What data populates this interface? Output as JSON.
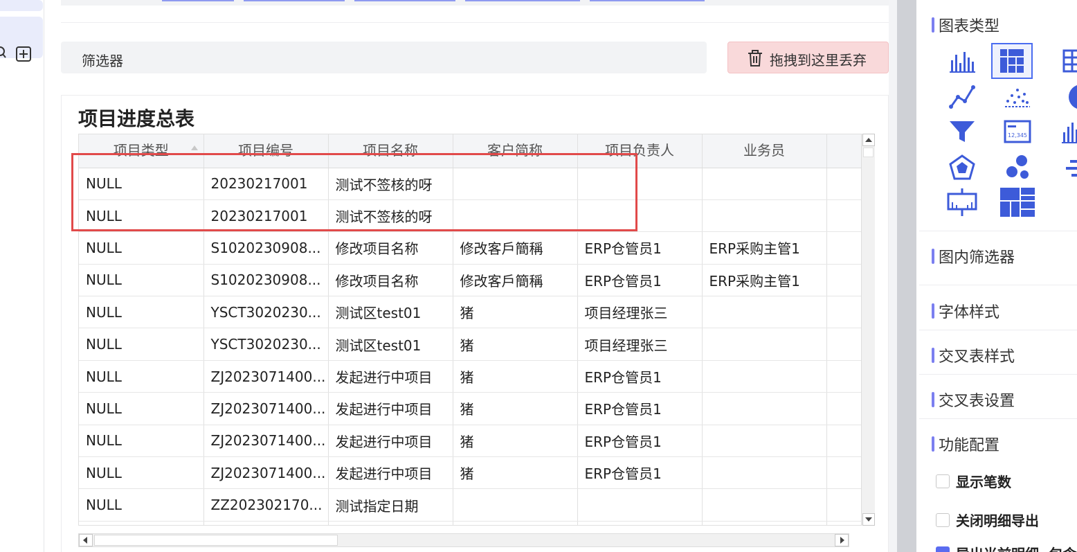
{
  "filter": {
    "label": "筛选器"
  },
  "drop_zone": {
    "label": "拖拽到这里丢弃"
  },
  "report": {
    "title": "项目进度总表",
    "columns": [
      "项目类型",
      "项目编号",
      "项目名称",
      "客户简称",
      "项目负责人",
      "业务员"
    ],
    "rows": [
      [
        "NULL",
        "20230217001",
        "测试不签核的呀",
        "",
        "",
        ""
      ],
      [
        "NULL",
        "20230217001",
        "测试不签核的呀",
        "",
        "",
        ""
      ],
      [
        "NULL",
        "S1020230908...",
        "修改项目名称",
        "修改客戶簡稱",
        "ERP仓管员1",
        "ERP采购主管1"
      ],
      [
        "NULL",
        "S1020230908...",
        "修改项目名称",
        "修改客戶簡稱",
        "ERP仓管员1",
        "ERP采购主管1"
      ],
      [
        "NULL",
        "YSCT3020230...",
        "测试区test01",
        "猪",
        "项目经理张三",
        ""
      ],
      [
        "NULL",
        "YSCT3020230...",
        "测试区test01",
        "猪",
        "项目经理张三",
        ""
      ],
      [
        "NULL",
        "ZJ2023071400...",
        "发起进行中项目",
        "猪",
        "ERP仓管员1",
        ""
      ],
      [
        "NULL",
        "ZJ2023071400...",
        "发起进行中项目",
        "猪",
        "ERP仓管员1",
        ""
      ],
      [
        "NULL",
        "ZJ2023071400...",
        "发起进行中项目",
        "猪",
        "ERP仓管员1",
        ""
      ],
      [
        "NULL",
        "ZJ2023071400...",
        "发起进行中项目",
        "猪",
        "ERP仓管员1",
        ""
      ],
      [
        "NULL",
        "ZZ202302170...",
        "测试指定日期",
        "",
        "",
        ""
      ],
      [
        "",
        "",
        "",
        "",
        "",
        ""
      ]
    ]
  },
  "panel": {
    "chart_type_title": "图表类型",
    "chart_icons": [
      "bar-chart-icon",
      "cross-table-icon",
      "table-icon",
      "line-chart-icon",
      "scatter-icon",
      "pie-icon",
      "funnel-icon",
      "kpi-card-icon",
      "stacked-bar-icon",
      "radar-icon",
      "bubble-icon",
      "gantt-icon",
      "boxplot-icon",
      "treemap-icon"
    ],
    "kpi_sample": "12,345",
    "sections": [
      "图内筛选器",
      "字体样式",
      "交叉表样式",
      "交叉表设置",
      "功能配置"
    ],
    "options": [
      {
        "label": "显示笔数",
        "checked": false
      },
      {
        "label": "关闭明细导出",
        "checked": false
      },
      {
        "label": "导出当前明细, 包含隐",
        "checked": true
      }
    ]
  },
  "colors": {
    "accent": "#5a6cf0",
    "highlight": "#e14a4a",
    "drop_zone": "#f9d9da"
  }
}
